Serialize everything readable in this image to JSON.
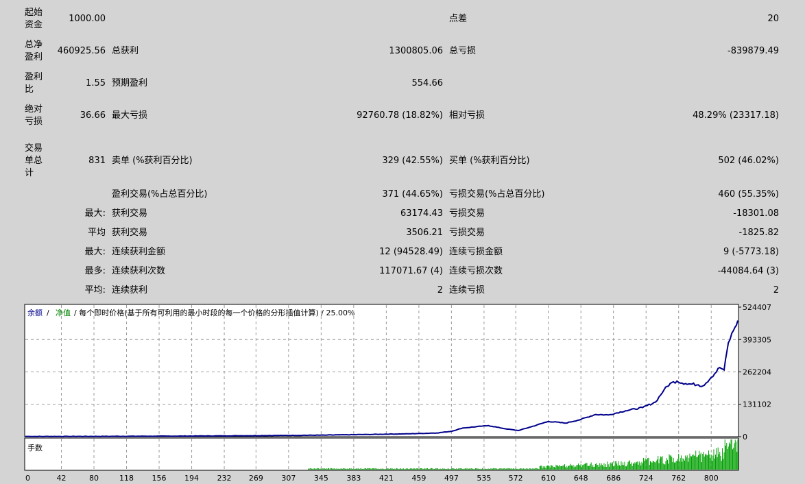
{
  "report": {
    "rows": [
      {
        "label": "起始资金",
        "value": "1000.00",
        "k1": "",
        "v1": "",
        "k2": "点差",
        "v2": "20"
      },
      {
        "label": "总净盈利",
        "value": "460925.56",
        "k1": "总获利",
        "v1": "1300805.06",
        "k2": "总亏损",
        "v2": "-839879.49"
      },
      {
        "label": "盈利比",
        "value": "1.55",
        "k1": "预期盈利",
        "v1": "554.66",
        "k2": "",
        "v2": ""
      },
      {
        "label": "绝对亏损",
        "value": "36.66",
        "k1": "最大亏损",
        "v1": "92760.78 (18.82%)",
        "k2": "相对亏损",
        "v2": "48.29% (23317.18)"
      },
      {
        "label": "交易单总计",
        "value": "831",
        "k1": "卖单 (%获利百分比)",
        "v1": "329 (42.55%)",
        "k2": "买单 (%获利百分比)",
        "v2": "502 (46.02%)"
      },
      {
        "label": "",
        "value": "",
        "k1": "盈利交易(%占总百分比)",
        "v1": "371 (44.65%)",
        "k2": "亏损交易(%占总百分比)",
        "v2": "460 (55.35%)"
      },
      {
        "label": "",
        "value": "最大:",
        "k1": "获利交易",
        "v1": "63174.43",
        "k2": "亏损交易",
        "v2": "-18301.08"
      },
      {
        "label": "",
        "value": "平均",
        "k1": "获利交易",
        "v1": "3506.21",
        "k2": "亏损交易",
        "v2": "-1825.82"
      },
      {
        "label": "",
        "value": "最大:",
        "k1": "连续获利金额",
        "v1": "12 (94528.49)",
        "k2": "连续亏损金额",
        "v2": "9 (-5773.18)"
      },
      {
        "label": "",
        "value": "最多:",
        "k1": "连续获利次数",
        "v1": "117071.67 (4)",
        "k2": "连续亏损次数",
        "v2": "-44084.64 (3)"
      },
      {
        "label": "",
        "value": "平均:",
        "k1": "连续获利",
        "v1": "2",
        "k2": "连续亏损",
        "v2": "2"
      }
    ]
  },
  "chart_header": {
    "balance": "余额",
    "sep1": " / ",
    "equity": "净值",
    "rest": " / 每个即时价格(基于所有可利用的最小时段的每一个价格的分形插值计算) / 25.00%"
  },
  "lots_label": "手数",
  "colors": {
    "balance": "#00008b",
    "equity": "#008000",
    "volume": "#00a000",
    "grid": "#9a9a9a"
  },
  "chart_data": {
    "type": "line",
    "title": "余额 / 净值 / 每个即时价格(基于所有可利用的最小时段的每一个价格的分形插值计算) / 25.00%",
    "y_ticks": [
      0,
      131102,
      262204,
      393305,
      524407
    ],
    "x_ticks": [
      0,
      42,
      80,
      118,
      156,
      194,
      232,
      269,
      307,
      345,
      383,
      421,
      459,
      497,
      535,
      572,
      610,
      648,
      686,
      724,
      762,
      800
    ],
    "ylim": [
      0,
      524407
    ],
    "xlim": [
      0,
      831
    ],
    "series": [
      {
        "name": "余额",
        "points": [
          [
            0,
            1000
          ],
          [
            50,
            1100
          ],
          [
            100,
            1500
          ],
          [
            150,
            2000
          ],
          [
            200,
            2800
          ],
          [
            250,
            3800
          ],
          [
            300,
            5000
          ],
          [
            350,
            6500
          ],
          [
            400,
            9000
          ],
          [
            450,
            12000
          ],
          [
            480,
            15000
          ],
          [
            497,
            22000
          ],
          [
            510,
            35000
          ],
          [
            540,
            45000
          ],
          [
            560,
            32000
          ],
          [
            575,
            25000
          ],
          [
            590,
            40000
          ],
          [
            610,
            62000
          ],
          [
            630,
            55000
          ],
          [
            648,
            70000
          ],
          [
            665,
            90000
          ],
          [
            680,
            88000
          ],
          [
            700,
            105000
          ],
          [
            720,
            118000
          ],
          [
            735,
            140000
          ],
          [
            745,
            190000
          ],
          [
            752,
            215000
          ],
          [
            760,
            225000
          ],
          [
            770,
            215000
          ],
          [
            785,
            210000
          ],
          [
            790,
            205000
          ],
          [
            800,
            240000
          ],
          [
            810,
            280000
          ],
          [
            815,
            270000
          ],
          [
            820,
            380000
          ],
          [
            826,
            430000
          ],
          [
            831,
            470000
          ]
        ]
      }
    ],
    "lots_series": {
      "name": "手数",
      "ylim": [
        0,
        1
      ]
    }
  }
}
